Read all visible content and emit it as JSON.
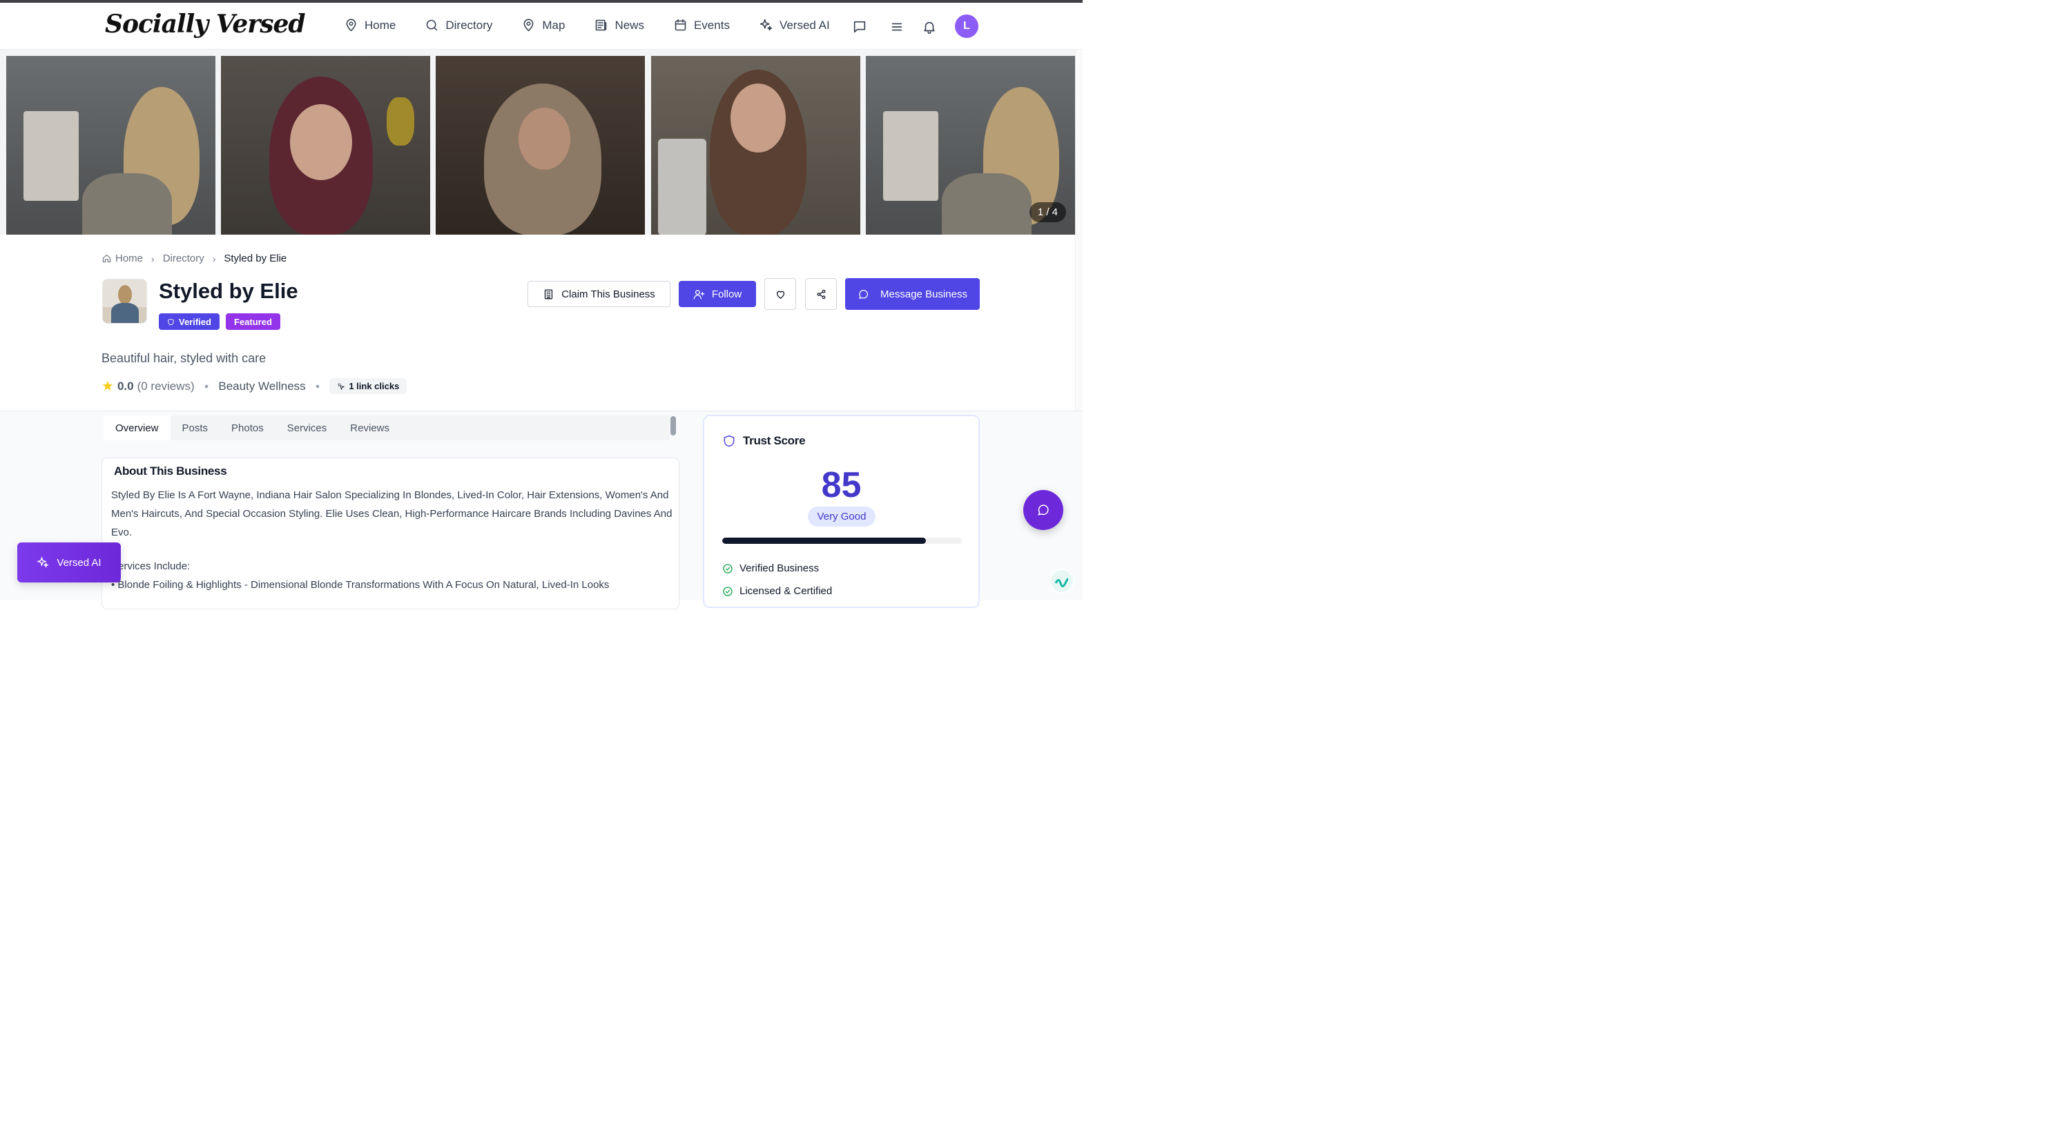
{
  "app": {
    "logo": "Socially Versed",
    "avatar_initial": "L"
  },
  "nav": [
    {
      "label": "Home",
      "icon": "map-pin-icon"
    },
    {
      "label": "Directory",
      "icon": "search-icon"
    },
    {
      "label": "Map",
      "icon": "map-pin-icon"
    },
    {
      "label": "News",
      "icon": "newspaper-icon"
    },
    {
      "label": "Events",
      "icon": "calendar-icon"
    },
    {
      "label": "Versed AI",
      "icon": "sparkles-icon"
    }
  ],
  "header_icons": [
    "chat-icon",
    "menu-icon",
    "bell-icon"
  ],
  "gallery": {
    "counter": "1 / 4",
    "photos": 5
  },
  "breadcrumb": {
    "home": "Home",
    "directory": "Directory",
    "current": "Styled by Elie"
  },
  "business": {
    "name": "Styled by Elie",
    "badges": {
      "verified": "Verified",
      "featured": "Featured"
    },
    "tagline": "Beautiful hair, styled with care",
    "rating": "0.0",
    "reviews": "(0 reviews)",
    "category": "Beauty Wellness",
    "link_clicks": "1 link clicks"
  },
  "actions": {
    "claim": "Claim This Business",
    "follow": "Follow",
    "message": "Message Business"
  },
  "tabs": [
    "Overview",
    "Posts",
    "Photos",
    "Services",
    "Reviews"
  ],
  "about": {
    "title": "About This Business",
    "text": "Styled By Elie Is A Fort Wayne, Indiana Hair Salon Specializing In Blondes, Lived-In Color, Hair Extensions, Women's And Men's Haircuts, And Special Occasion Styling. Elie Uses Clean, High-Performance Haircare Brands Including Davines And Evo.",
    "services_heading": "Services Include:",
    "services_first": "• Blonde Foiling & Highlights - Dimensional Blonde Transformations With A Focus On Natural, Lived-In Looks"
  },
  "trust": {
    "title": "Trust Score",
    "score": "85",
    "score_value": 0.85,
    "label": "Very Good",
    "items": [
      "Verified Business",
      "Licensed & Certified"
    ]
  },
  "floating": {
    "versed_ai": "Versed AI"
  },
  "colors": {
    "primary": "#4f46e5",
    "featured": "#9333ea",
    "accent_purple": "#6d28d9",
    "check_green": "#16a34a"
  }
}
